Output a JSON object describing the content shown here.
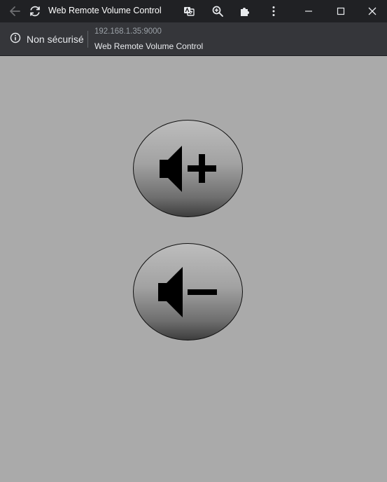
{
  "window": {
    "title": "Web Remote Volume Control",
    "icons": [
      "back-arrow-icon",
      "reload-icon",
      "translate-icon",
      "zoom-icon",
      "extensions-icon",
      "more-icon",
      "minimize-icon",
      "maximize-icon",
      "close-icon"
    ]
  },
  "infobar": {
    "security_label": "Non sécurisé",
    "security_icon": "info-icon",
    "url": "192.168.1.35:9000",
    "page_title": "Web Remote Volume Control"
  },
  "controls": {
    "volume_up_icon": "volume-up-icon",
    "volume_down_icon": "volume-down-icon"
  },
  "colors": {
    "page_background": "#aaaaaa",
    "titlebar": "#202124",
    "infobar": "#35363a"
  }
}
